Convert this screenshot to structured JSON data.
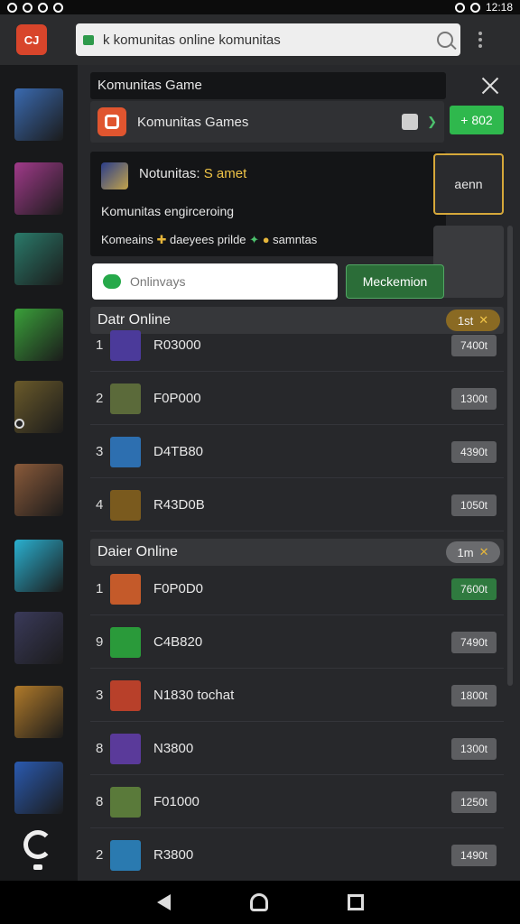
{
  "status_bar": {
    "time": "12:18"
  },
  "browser": {
    "url": "k komunitas online komunitas",
    "app_logo": "CJ"
  },
  "panel": {
    "header_title": "Komunitas Game",
    "game_row": {
      "label": "Komunitas Games"
    },
    "green_pill": "+ 802",
    "notification": {
      "title_prefix": "Notunitas:",
      "title_highlight": "S amet",
      "line2": "Komunitas engirceroing",
      "line3_a": "Komeains",
      "line3_b": "daeyees prilde",
      "line3_c": "samntas"
    },
    "side_card": "aenn",
    "search": {
      "placeholder": "Onlinvays"
    },
    "recommend_button": "Meckemion"
  },
  "sections": [
    {
      "title": "Datr Online",
      "badge": "1st",
      "badge_color": "#8a6a23",
      "rows": [
        {
          "rank": "1",
          "name": "R03000",
          "score": "7400t",
          "thumb": "#4b3a9a",
          "green": false
        },
        {
          "rank": "2",
          "name": "F0P000",
          "score": "1300t",
          "thumb": "#5b6a3a",
          "green": false
        },
        {
          "rank": "3",
          "name": "D4TB80",
          "score": "4390t",
          "thumb": "#2d6fb0",
          "green": false
        },
        {
          "rank": "4",
          "name": "R43D0B",
          "score": "1050t",
          "thumb": "#7a5a1e",
          "green": false
        }
      ]
    },
    {
      "title": "Daier Online",
      "badge": "1m",
      "badge_color": "#6a6b6e",
      "rows": [
        {
          "rank": "1",
          "name": "F0P0D0",
          "score": "7600t",
          "thumb": "#c45a2a",
          "green": true
        },
        {
          "rank": "9",
          "name": "C4B820",
          "score": "7490t",
          "thumb": "#2a9a3a",
          "green": false
        },
        {
          "rank": "3",
          "name": "N1830 tochat",
          "score": "1800t",
          "thumb": "#b8402a",
          "green": false
        },
        {
          "rank": "8",
          "name": "N3800",
          "score": "1300t",
          "thumb": "#5a3a9a",
          "green": false
        },
        {
          "rank": "8",
          "name": "F01000",
          "score": "1250t",
          "thumb": "#5a7a3a",
          "green": false
        },
        {
          "rank": "2",
          "name": "R3800",
          "score": "1490t",
          "thumb": "#2a7ab0",
          "green": false
        }
      ]
    }
  ],
  "left_rail_colors": [
    "#3a6ab0",
    "#a03a8a",
    "#2a7a6a",
    "#3aa03a",
    "#6a5a2a",
    "#8a5a3a",
    "#2ab0d0",
    "#3a3a5a",
    "#b07a2a",
    "#2a5ab0"
  ]
}
